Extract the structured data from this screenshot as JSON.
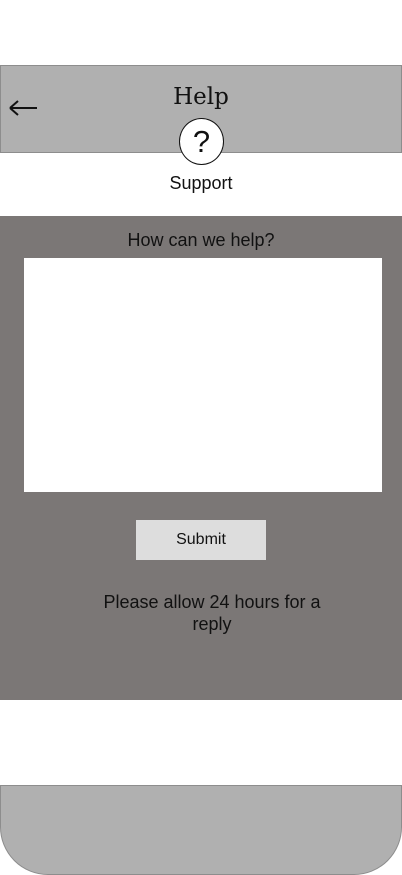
{
  "header": {
    "title": "Help",
    "back_icon": "left-arrow-icon",
    "background_color": "#b0b0b0"
  },
  "support": {
    "icon_glyph": "?",
    "label": "Support"
  },
  "form": {
    "prompt": "How can we help?",
    "message_value": "",
    "submit_label": "Submit",
    "note": "Please allow 24 hours for a reply",
    "panel_color": "#7b7776"
  },
  "footer": {
    "background_color": "#b0b0b0"
  }
}
